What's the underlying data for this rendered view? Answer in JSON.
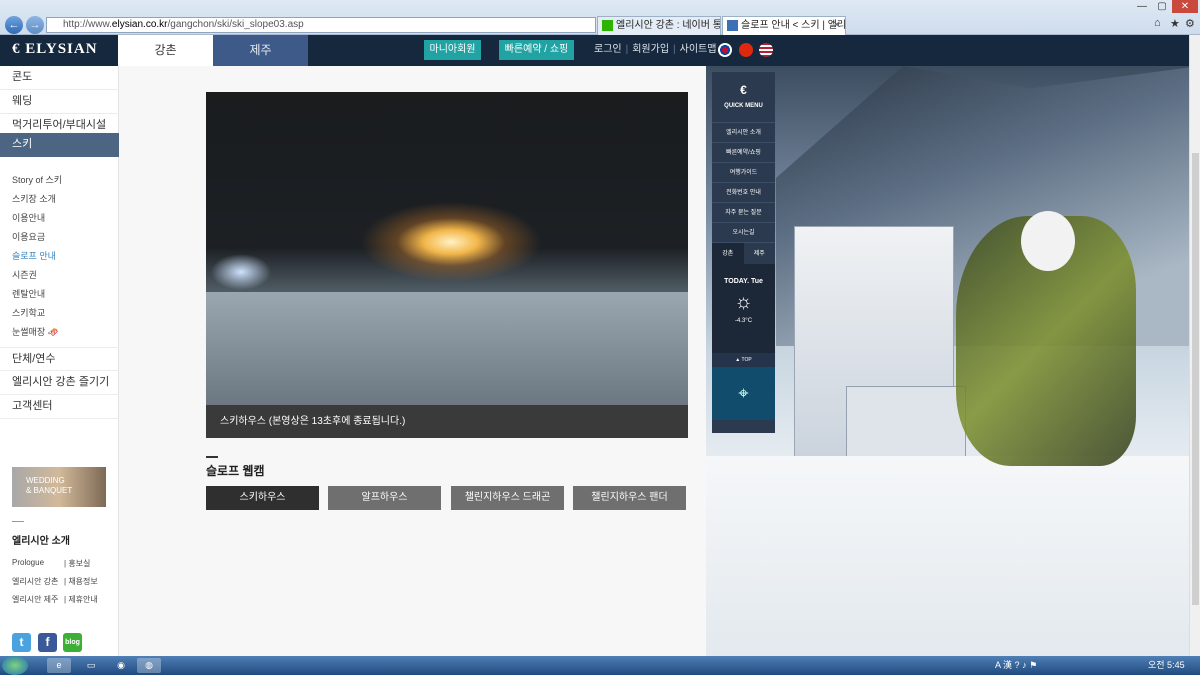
{
  "browser": {
    "address_prefix": "http://www.",
    "address_domain": "elysian.co.kr",
    "address_path": "/gangchon/ski/ski_slope03.asp",
    "tabs": [
      {
        "label": "엘리시안 강촌 : 네이버 통합검..."
      },
      {
        "label": "슬로프 안내 < 스키 | 엘리..."
      }
    ]
  },
  "header": {
    "logo": "ELYSIAN",
    "tab_gangchon": "강촌",
    "tab_jeju": "제주",
    "mania_button": "마니아회원",
    "booking_button": "빠른예약 / 쇼핑",
    "login": "로그인",
    "signup": "회원가입",
    "sitemap": "사이트맵",
    "colors": {
      "nav_bg": "#16283e",
      "accent": "#22a3a3",
      "jeju_tab": "#3d5a88"
    }
  },
  "sidebar": {
    "main_items": [
      "콘도",
      "웨딩",
      "먹거리투어/부대시설",
      "스키",
      "단체/연수",
      "엘리시안 강촌 즐기기",
      "고객센터"
    ],
    "sub_items": [
      "Story of 스키",
      "스키장 소개",
      "이용안내",
      "이용요금",
      "슬로프 안내",
      "시즌권",
      "렌탈안내",
      "스키학교",
      "눈썰매장"
    ],
    "banner_line1": "WEDDING",
    "banner_line2": "& BANQUET",
    "info_title": "엘리시안 소개",
    "info_links": [
      [
        "Prologue",
        "홍보실"
      ],
      [
        "엘리시안 강촌",
        "채용정보"
      ],
      [
        "엘리시안 제주",
        "제휴안내"
      ]
    ]
  },
  "main": {
    "video_caption": "스키하우스 (본영상은 13초후에 종료됩니다.)",
    "section_title": "슬로프 웹캠",
    "webcam_buttons": [
      "스키하우스",
      "알프하우스",
      "챌린지하우스 드래곤",
      "챌린지하우스 팬더"
    ]
  },
  "quick_menu": {
    "title": "QUICK MENU",
    "items": [
      "엘리시안 소개",
      "빠른예약/쇼핑",
      "여행가이드",
      "전화번호 안내",
      "자주 묻는 질문",
      "오시는길"
    ],
    "tab_gangchon": "강촌",
    "tab_jeju": "제주",
    "today": "TODAY. Tue",
    "temperature": "-4.3°C",
    "top": "▲ TOP"
  },
  "taskbar": {
    "tray": "A 漢",
    "clock": "오전 5:45"
  }
}
